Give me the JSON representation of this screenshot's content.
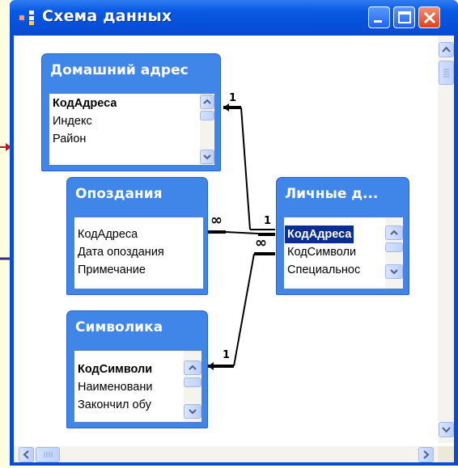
{
  "window": {
    "title": "Схема данных"
  },
  "tables": {
    "home_address": {
      "title": "Домашний адрес",
      "fields": [
        "КодАдреса",
        "Индекс",
        "Район"
      ]
    },
    "delays": {
      "title": "Опоздания",
      "fields": [
        "КодАдреса",
        "Дата опоздания",
        "Примечание"
      ]
    },
    "personal": {
      "title": "Личные д...",
      "fields": [
        "КодАдреса",
        "КодСимволи",
        "Специальнос"
      ]
    },
    "symbols": {
      "title": "Символика",
      "fields": [
        "КодСимволи",
        "Наименовани",
        "Закончил обу"
      ]
    }
  },
  "relations": {
    "one": "1",
    "many": "∞"
  },
  "colors": {
    "title_bar": "#0a5ae4",
    "table_header": "#3f86e8",
    "background": "#fffde0",
    "close_button": "#d9421d"
  }
}
